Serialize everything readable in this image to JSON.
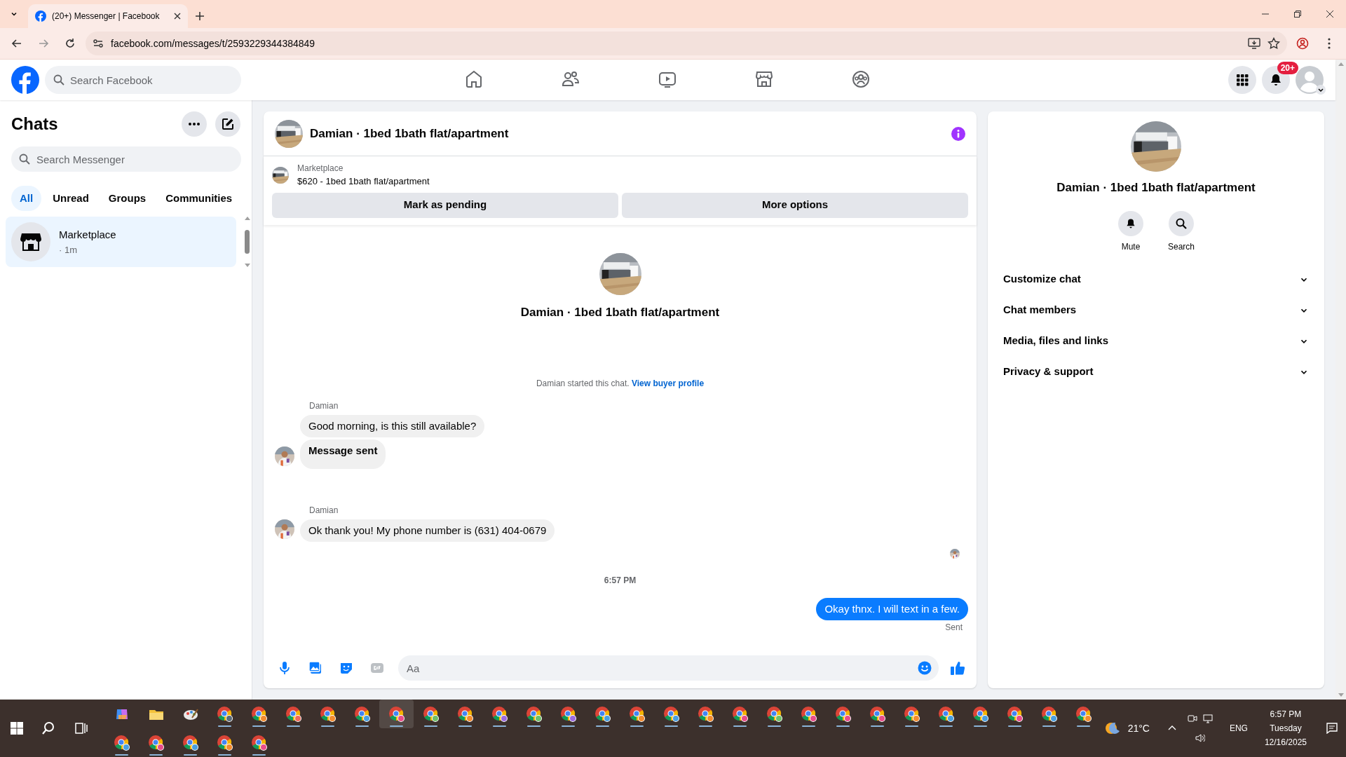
{
  "browser": {
    "tab_title": "(20+) Messenger | Facebook",
    "url": "facebook.com/messages/t/2593229344384849"
  },
  "header": {
    "search_placeholder": "Search Facebook",
    "nav": [
      {
        "kind": "home",
        "selected": false
      },
      {
        "kind": "friends",
        "selected": false
      },
      {
        "kind": "video",
        "selected": false
      },
      {
        "kind": "marketplace",
        "selected": false
      },
      {
        "kind": "groups",
        "selected": false
      }
    ],
    "notification_badge": "20+"
  },
  "sidebar": {
    "title": "Chats",
    "search_placeholder": "Search Messenger",
    "filters": [
      {
        "label": "All",
        "selected": true
      },
      {
        "label": "Unread",
        "selected": false
      },
      {
        "label": "Groups",
        "selected": false
      },
      {
        "label": "Communities",
        "selected": false
      }
    ],
    "chats": [
      {
        "name": "Marketplace",
        "meta": "· 1m",
        "selected": true
      }
    ]
  },
  "conversation": {
    "title": "Damian · 1bed 1bath flat/apartment",
    "listing": {
      "source": "Marketplace",
      "title": "$620 - 1bed 1bath flat/apartment"
    },
    "actions": [
      "Mark as pending",
      "More options"
    ],
    "intro_name": "Damian · 1bed 1bath flat/apartment",
    "notice": {
      "text": "Damian started this chat.",
      "link": "View buyer profile"
    },
    "timeline": [
      {
        "kind": "incoming",
        "sender": "Damian",
        "messages": [
          {
            "kind": "text",
            "text": "Good morning, is this still available?"
          },
          {
            "kind": "notice",
            "text": "Message sent"
          }
        ]
      },
      {
        "kind": "incoming",
        "sender": "Damian",
        "messages": [
          {
            "kind": "text",
            "text": "Ok thank you! My phone number is (631) 404-0679"
          }
        ]
      },
      {
        "kind": "read_receipt"
      },
      {
        "kind": "time",
        "text": "6:57 PM"
      },
      {
        "kind": "outgoing",
        "status": "Sent",
        "messages": [
          {
            "kind": "text",
            "text": "Okay thnx. I will text in a few."
          }
        ]
      }
    ],
    "composer": {
      "placeholder": "Aa"
    }
  },
  "details": {
    "name": "Damian · 1bed 1bath flat/apartment",
    "actions": [
      "Mute",
      "Search"
    ],
    "sections": [
      {
        "label": "Customize chat",
        "expanded": false
      },
      {
        "label": "Chat members",
        "expanded": false
      },
      {
        "label": "Media, files and links",
        "expanded": false
      },
      {
        "label": "Privacy & support",
        "expanded": false
      }
    ]
  },
  "taskbar": {
    "apps": [
      {
        "kind": "copilot",
        "selected": false
      },
      {
        "kind": "explorer",
        "selected": false
      },
      {
        "kind": "paint",
        "selected": false
      },
      {
        "kind": "chrome",
        "color": "#5b6b7a",
        "selected": false
      },
      {
        "kind": "chrome",
        "color": "#f28b30",
        "selected": false
      },
      {
        "kind": "chrome",
        "color": "#f06a5a",
        "selected": false
      },
      {
        "kind": "chrome",
        "color": "#f28b30",
        "selected": false
      },
      {
        "kind": "chrome",
        "color": "#4a9fe0",
        "selected": false
      },
      {
        "kind": "chrome",
        "color": "#e84d8a",
        "selected": true
      },
      {
        "kind": "chrome",
        "color": "#6fbf6a",
        "selected": false
      },
      {
        "kind": "chrome",
        "color": "#f28b30",
        "selected": false
      },
      {
        "kind": "chrome",
        "color": "#9b6be0",
        "selected": false
      },
      {
        "kind": "chrome",
        "color": "#6fbf6a",
        "selected": false
      },
      {
        "kind": "chrome",
        "color": "#9b6be0",
        "selected": false
      },
      {
        "kind": "chrome",
        "color": "#4a9fe0",
        "selected": false
      },
      {
        "kind": "chrome",
        "color": "#f28b30",
        "selected": false
      },
      {
        "kind": "chrome",
        "color": "#4a9fe0",
        "selected": false
      },
      {
        "kind": "chrome",
        "color": "#f28b30",
        "selected": false
      },
      {
        "kind": "chrome",
        "color": "#e84d8a",
        "selected": false
      },
      {
        "kind": "chrome",
        "color": "#6fbf6a",
        "selected": false
      },
      {
        "kind": "chrome",
        "color": "#e84d8a",
        "selected": false
      },
      {
        "kind": "chrome",
        "color": "#e84d8a",
        "selected": false
      },
      {
        "kind": "chrome",
        "color": "#e84d8a",
        "selected": false
      },
      {
        "kind": "chrome",
        "color": "#f28b30",
        "selected": false
      },
      {
        "kind": "chrome",
        "color": "#4a9fe0",
        "selected": false
      },
      {
        "kind": "chrome",
        "color": "#4a9fe0",
        "selected": false
      },
      {
        "kind": "chrome",
        "color": "#e84d8a",
        "selected": false
      },
      {
        "kind": "chrome",
        "color": "#4a9fe0",
        "selected": false
      },
      {
        "kind": "chrome",
        "color": "#f28b30",
        "selected": false
      },
      {
        "kind": "chrome",
        "color": "#4a9fe0",
        "selected": false
      },
      {
        "kind": "chrome",
        "color": "#e84d8a",
        "selected": false
      },
      {
        "kind": "chrome",
        "color": "#4a9fe0",
        "selected": false
      },
      {
        "kind": "chrome",
        "color": "#f28b30",
        "selected": false
      },
      {
        "kind": "chrome",
        "color": "#e84d8a",
        "selected": false
      }
    ],
    "weather": "21°C",
    "language": "ENG",
    "time": "6:57 PM",
    "day": "Tuesday",
    "date": "12/16/2025"
  }
}
